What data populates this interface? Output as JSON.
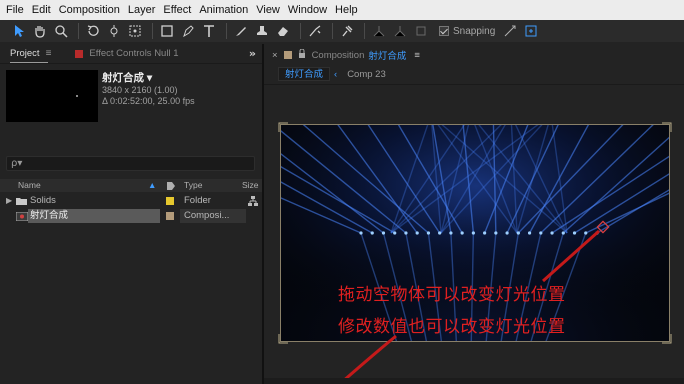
{
  "menu": [
    "File",
    "Edit",
    "Composition",
    "Layer",
    "Effect",
    "Animation",
    "View",
    "Window",
    "Help"
  ],
  "toolbar": {
    "snapping_label": "Snapping"
  },
  "project_panel": {
    "tab_label": "Project",
    "effect_controls_label": "Effect Controls Null 1",
    "selected_item": {
      "name": "射灯合成 ▾",
      "resolution": "3840 x 2160 (1.00)",
      "duration": "Δ 0:02:52:00, 25.00 fps"
    },
    "search_placeholder": "ρ▾",
    "columns": {
      "name": "Name",
      "type": "Type",
      "size": "Size"
    },
    "rows": [
      {
        "name": "Solids",
        "type": "Folder",
        "label_color": "#e6c82e",
        "selected": false
      },
      {
        "name": "射灯合成",
        "type": "Composi...",
        "label_color": "#b39b7a",
        "selected": true
      }
    ]
  },
  "composition_panel": {
    "tab_prefix": "Composition",
    "tab_name": "射灯合成",
    "breadcrumb_active": "射灯合成",
    "breadcrumb_other": "Comp 23"
  },
  "annotations": {
    "line1": "拖动空物体可以改变灯光位置",
    "line2": "修改数值也可以改变灯光位置"
  },
  "colors": {
    "accent_blue": "#3f9cff",
    "annotation_red": "#e02020",
    "light_blue": "#3a7cff"
  }
}
